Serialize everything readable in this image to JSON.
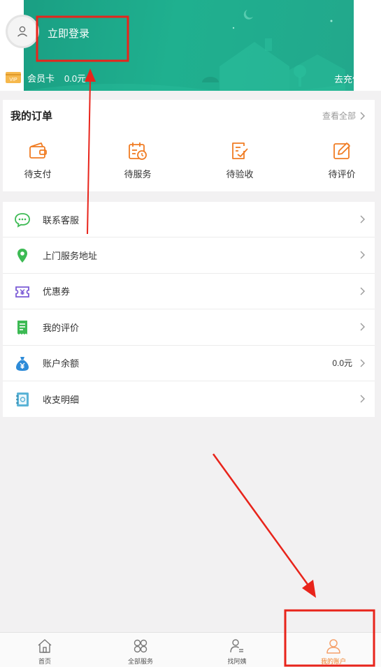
{
  "header": {
    "login_label": "立即登录",
    "member_card_label": "会员卡",
    "member_card_value": "0.0元",
    "recharge_label": "去充值",
    "vip_badge": "VIP"
  },
  "orders": {
    "title": "我的订单",
    "view_all": "查看全部",
    "items": [
      {
        "label": "待支付",
        "icon": "wallet-icon"
      },
      {
        "label": "待服务",
        "icon": "calendar-clock-icon"
      },
      {
        "label": "待验收",
        "icon": "checklist-icon"
      },
      {
        "label": "待评价",
        "icon": "edit-icon"
      }
    ]
  },
  "menu": {
    "items": [
      {
        "label": "联系客服",
        "icon": "chat-bubble-icon",
        "value": ""
      },
      {
        "label": "上门服务地址",
        "icon": "location-pin-icon",
        "value": ""
      },
      {
        "label": "优惠券",
        "icon": "coupon-icon",
        "value": ""
      },
      {
        "label": "我的评价",
        "icon": "receipt-icon",
        "value": ""
      },
      {
        "label": "账户余额",
        "icon": "money-bag-icon",
        "value": "0.0元"
      },
      {
        "label": "收支明细",
        "icon": "ledger-icon",
        "value": ""
      }
    ]
  },
  "tabbar": {
    "items": [
      {
        "label": "首页",
        "icon": "home-icon",
        "active": false
      },
      {
        "label": "全部服务",
        "icon": "grid-icon",
        "active": false
      },
      {
        "label": "找阿姨",
        "icon": "person-search-icon",
        "active": false
      },
      {
        "label": "我的账户",
        "icon": "user-icon",
        "active": true
      }
    ]
  },
  "colors": {
    "banner": "#1fab8b",
    "accent_orange": "#f07c23",
    "annotation_red": "#e8241b"
  }
}
